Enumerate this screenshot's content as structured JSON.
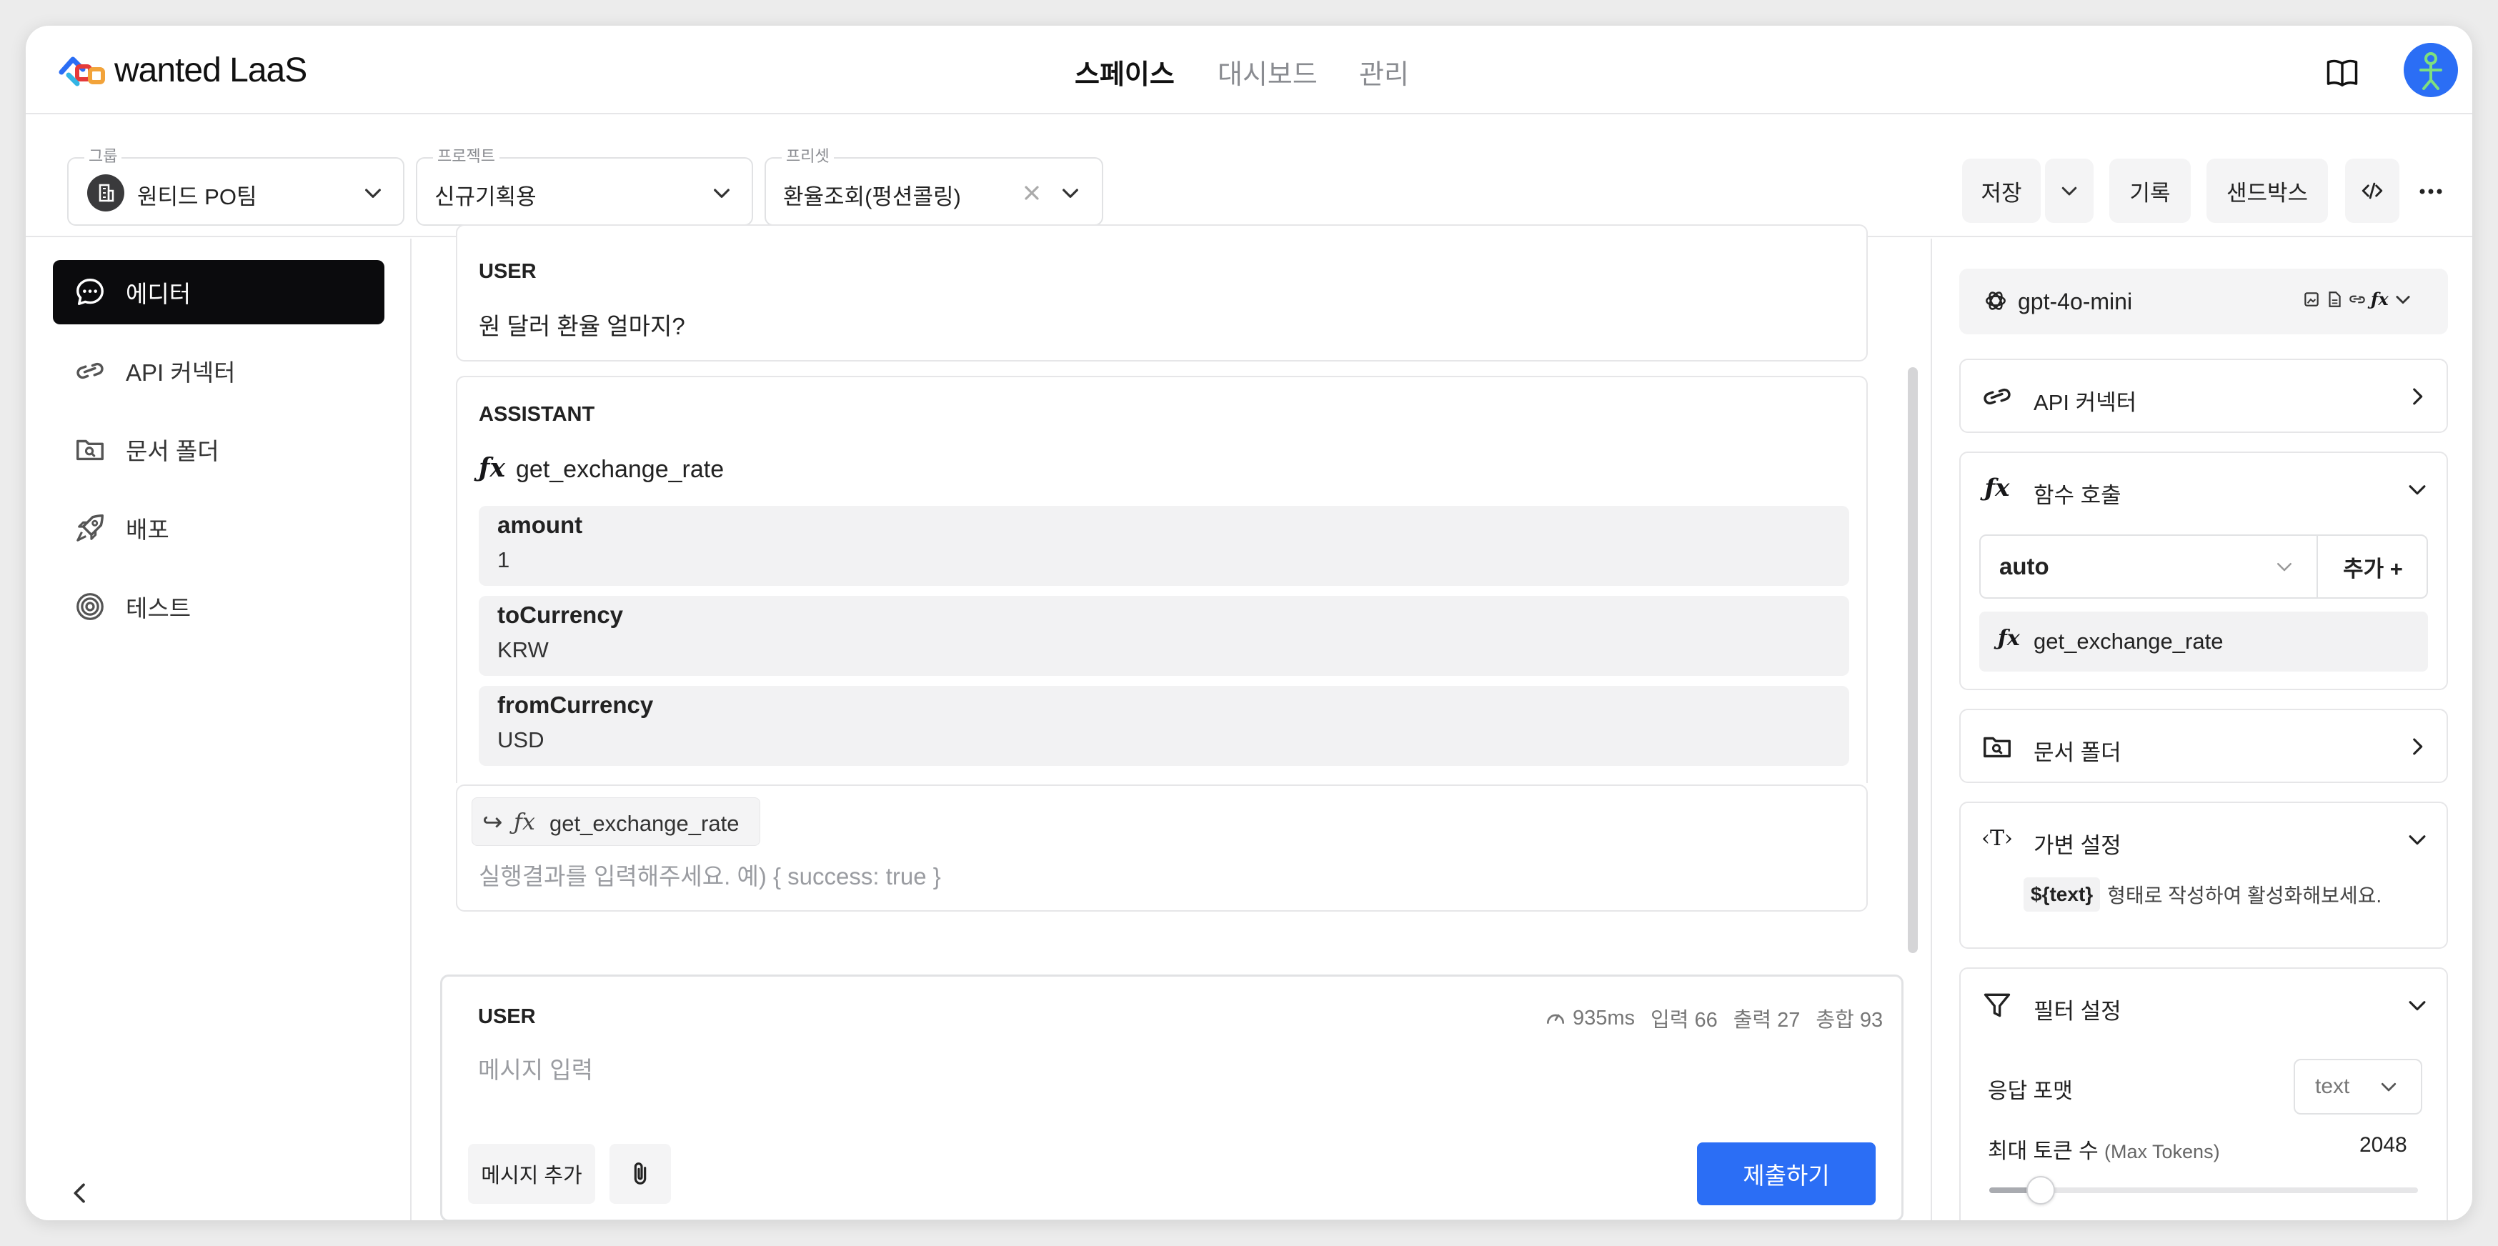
{
  "app": {
    "logo_text": "wanted LaaS"
  },
  "nav": {
    "items": [
      "스페이스",
      "대시보드",
      "관리"
    ],
    "active": 0
  },
  "toolbar": {
    "group": {
      "label": "그룹",
      "value": "원티드 PO팀"
    },
    "project": {
      "label": "프로젝트",
      "value": "신규기획용"
    },
    "preset": {
      "label": "프리셋",
      "value": "환율조회(펑션콜링)"
    },
    "save": "저장",
    "history": "기록",
    "sandbox": "샌드박스"
  },
  "sidebar": {
    "items": [
      {
        "label": "에디터",
        "icon": "chat-bubble-icon"
      },
      {
        "label": "API 커넥터",
        "icon": "link-icon"
      },
      {
        "label": "문서 폴더",
        "icon": "folder-search-icon"
      },
      {
        "label": "배포",
        "icon": "rocket-icon"
      },
      {
        "label": "테스트",
        "icon": "target-icon"
      }
    ],
    "active": 0
  },
  "messages": {
    "user": {
      "role": "USER",
      "text": "원 달러 환율 얼마지?"
    },
    "assistant": {
      "role": "ASSISTANT",
      "function": "get_exchange_rate",
      "params": [
        {
          "name": "amount",
          "value": "1"
        },
        {
          "name": "toCurrency",
          "value": "KRW"
        },
        {
          "name": "fromCurrency",
          "value": "USD"
        }
      ]
    },
    "tool_result": {
      "function": "get_exchange_rate",
      "placeholder": "실행결과를 입력해주세요. 예) { success: true }"
    }
  },
  "composer": {
    "role": "USER",
    "stats": {
      "latency": "935ms",
      "input": "입력 66",
      "output": "출력 27",
      "total": "총합 93"
    },
    "placeholder": "메시지 입력",
    "add_message": "메시지 추가",
    "submit": "제출하기"
  },
  "right": {
    "model": "gpt-4o-mini",
    "api_connector": "API 커넥터",
    "function_call": {
      "title": "함수 호출",
      "mode": "auto",
      "add": "추가 +",
      "function": "get_exchange_rate"
    },
    "doc_folder": "문서 폴더",
    "variables": {
      "title": "가변 설정",
      "tag": "${text}",
      "hint": "형태로 작성하여 활성화해보세요."
    },
    "filter": {
      "title": "필터 설정",
      "format_label": "응답 포맷",
      "format_value": "text",
      "max_tokens_label": "최대 토큰 수",
      "max_tokens_sub": "(Max Tokens)",
      "max_tokens_value": "2048",
      "max_tokens_fraction": 0.12
    }
  },
  "colors": {
    "primary": "#2b6ef5",
    "dark": "#0b0b0d",
    "muted": "#8a8c91"
  }
}
